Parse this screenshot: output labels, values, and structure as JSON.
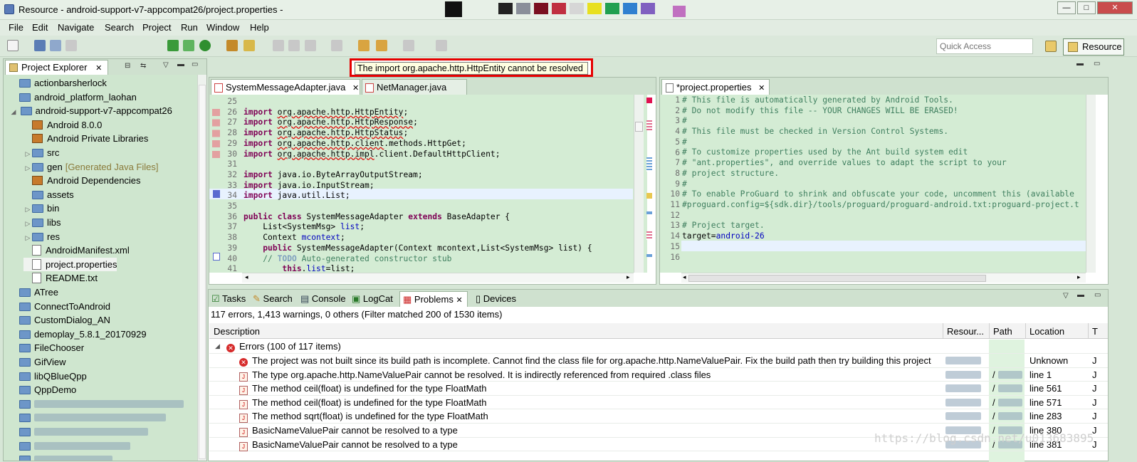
{
  "window": {
    "title": "Resource - android-support-v7-appcompat26/project.properties -",
    "controls": {
      "minimize": "—",
      "maximize": "□",
      "close": "✕"
    }
  },
  "menu": [
    "File",
    "Edit",
    "Navigate",
    "Search",
    "Project",
    "Run",
    "Window",
    "Help"
  ],
  "toolbar": {
    "quick_access_placeholder": "Quick Access",
    "perspective_label": "Resource"
  },
  "tooltip": {
    "text": "The import org.apache.http.HttpEntity cannot be resolved"
  },
  "project_explorer": {
    "tab_label": "Project Explorer",
    "items": [
      {
        "label": "actionbarsherlock",
        "kind": "folder",
        "indent": 0
      },
      {
        "label": "android_platform_laohan",
        "kind": "folder",
        "indent": 0
      },
      {
        "label": "android-support-v7-appcompat26",
        "kind": "folder",
        "indent": 0,
        "expanded": true,
        "selected": true
      },
      {
        "label": "Android 8.0.0",
        "kind": "lib",
        "indent": 1
      },
      {
        "label": "Android Private Libraries",
        "kind": "lib",
        "indent": 1
      },
      {
        "label": "src",
        "kind": "folder",
        "indent": 1
      },
      {
        "label": "gen",
        "suffix": "[Generated Java Files]",
        "kind": "folder",
        "indent": 1
      },
      {
        "label": "Android Dependencies",
        "kind": "lib",
        "indent": 1
      },
      {
        "label": "assets",
        "kind": "folder",
        "indent": 1
      },
      {
        "label": "bin",
        "kind": "folder",
        "indent": 1
      },
      {
        "label": "libs",
        "kind": "folder",
        "indent": 1
      },
      {
        "label": "res",
        "kind": "folder",
        "indent": 1
      },
      {
        "label": "AndroidManifest.xml",
        "kind": "file",
        "indent": 1
      },
      {
        "label": "project.properties",
        "kind": "file",
        "indent": 1,
        "highlight": true
      },
      {
        "label": "README.txt",
        "kind": "file",
        "indent": 1
      },
      {
        "label": "ATree",
        "kind": "folder",
        "indent": 0
      },
      {
        "label": "ConnectToAndroid",
        "kind": "folder",
        "indent": 0
      },
      {
        "label": "CustomDialog_AN",
        "kind": "folder",
        "indent": 0
      },
      {
        "label": "demoplay_5.8.1_20170929",
        "kind": "folder",
        "indent": 0
      },
      {
        "label": "FileChooser",
        "kind": "folder",
        "indent": 0
      },
      {
        "label": "GifView",
        "kind": "folder",
        "indent": 0
      },
      {
        "label": "libQBlueQpp",
        "kind": "folder",
        "indent": 0
      },
      {
        "label": "QppDemo",
        "kind": "folder",
        "indent": 0
      }
    ]
  },
  "editor_left": {
    "tabs": [
      {
        "label": "SystemMessageAdapter.java",
        "active": true,
        "close": "✕"
      },
      {
        "label": "NetManager.java",
        "active": false
      }
    ],
    "line_numbers": [
      "25",
      "26",
      "27",
      "28",
      "29",
      "30",
      "31",
      "32",
      "33",
      "34",
      "35",
      "36",
      "37",
      "38",
      "39",
      "40",
      "41"
    ]
  },
  "editor_right": {
    "tabs": [
      {
        "label": "*project.properties",
        "active": true,
        "close": "✕"
      }
    ],
    "line_numbers": [
      "1",
      "2",
      "3",
      "4",
      "5",
      "6",
      "7",
      "8",
      "9",
      "10",
      "11",
      "12",
      "13",
      "14",
      "15",
      "16"
    ],
    "lines": [
      "# This file is automatically generated by Android Tools.",
      "# Do not modify this file -- YOUR CHANGES WILL BE ERASED!",
      "#",
      "# This file must be checked in Version Control Systems.",
      "#",
      "# To customize properties used by the Ant build system edit",
      "# \"ant.properties\", and override values to adapt the script to your",
      "# project structure.",
      "#",
      "# To enable ProGuard to shrink and obfuscate your code, uncomment this (available",
      "#proguard.config=${sdk.dir}/tools/proguard/proguard-android.txt:proguard-project.t",
      "",
      "# Project target.",
      "target=android-26",
      "",
      ""
    ]
  },
  "problems": {
    "tabs": [
      {
        "label": "Tasks"
      },
      {
        "label": "Search"
      },
      {
        "label": "Console"
      },
      {
        "label": "LogCat"
      },
      {
        "label": "Problems",
        "active": true,
        "close": "✕"
      },
      {
        "label": "Devices"
      }
    ],
    "summary": "117 errors, 1,413 warnings, 0 others (Filter matched 200 of 1530 items)",
    "columns": [
      "Description",
      "Resour...",
      "Path",
      "Location",
      "T"
    ],
    "group": "Errors (100 of 117 items)",
    "rows": [
      {
        "description": "The project was not built since its build path is incomplete. Cannot find the class file for org.apache.http.NameValuePair. Fix the build path then try building this project",
        "path": "",
        "location": "Unknown",
        "type": "J",
        "icon": "error"
      },
      {
        "description": "The type org.apache.http.NameValuePair cannot be resolved. It is indirectly referenced from required .class files",
        "path": "/",
        "location": "line 1",
        "type": "J",
        "icon": "java"
      },
      {
        "description": "The method ceil(float) is undefined for the type FloatMath",
        "path": "/",
        "location": "line 561",
        "type": "J",
        "icon": "java"
      },
      {
        "description": "The method ceil(float) is undefined for the type FloatMath",
        "path": "/",
        "location": "line 571",
        "type": "J",
        "icon": "java"
      },
      {
        "description": "The method sqrt(float) is undefined for the type FloatMath",
        "path": "/",
        "location": "line 283",
        "type": "J",
        "icon": "java"
      },
      {
        "description": "BasicNameValuePair cannot be resolved to a type",
        "path": "/",
        "location": "line 380",
        "type": "J",
        "icon": "java"
      },
      {
        "description": "BasicNameValuePair cannot be resolved to a type",
        "path": "/",
        "location": "line 381",
        "type": "J",
        "icon": "java"
      }
    ]
  },
  "watermark": "https://blog.csdn.net/u013683895",
  "colors": {
    "editor_bg": "#d4ecd4",
    "current_line": "#e8f2fe",
    "error": "#e00000",
    "keyword": "#7f0055"
  }
}
